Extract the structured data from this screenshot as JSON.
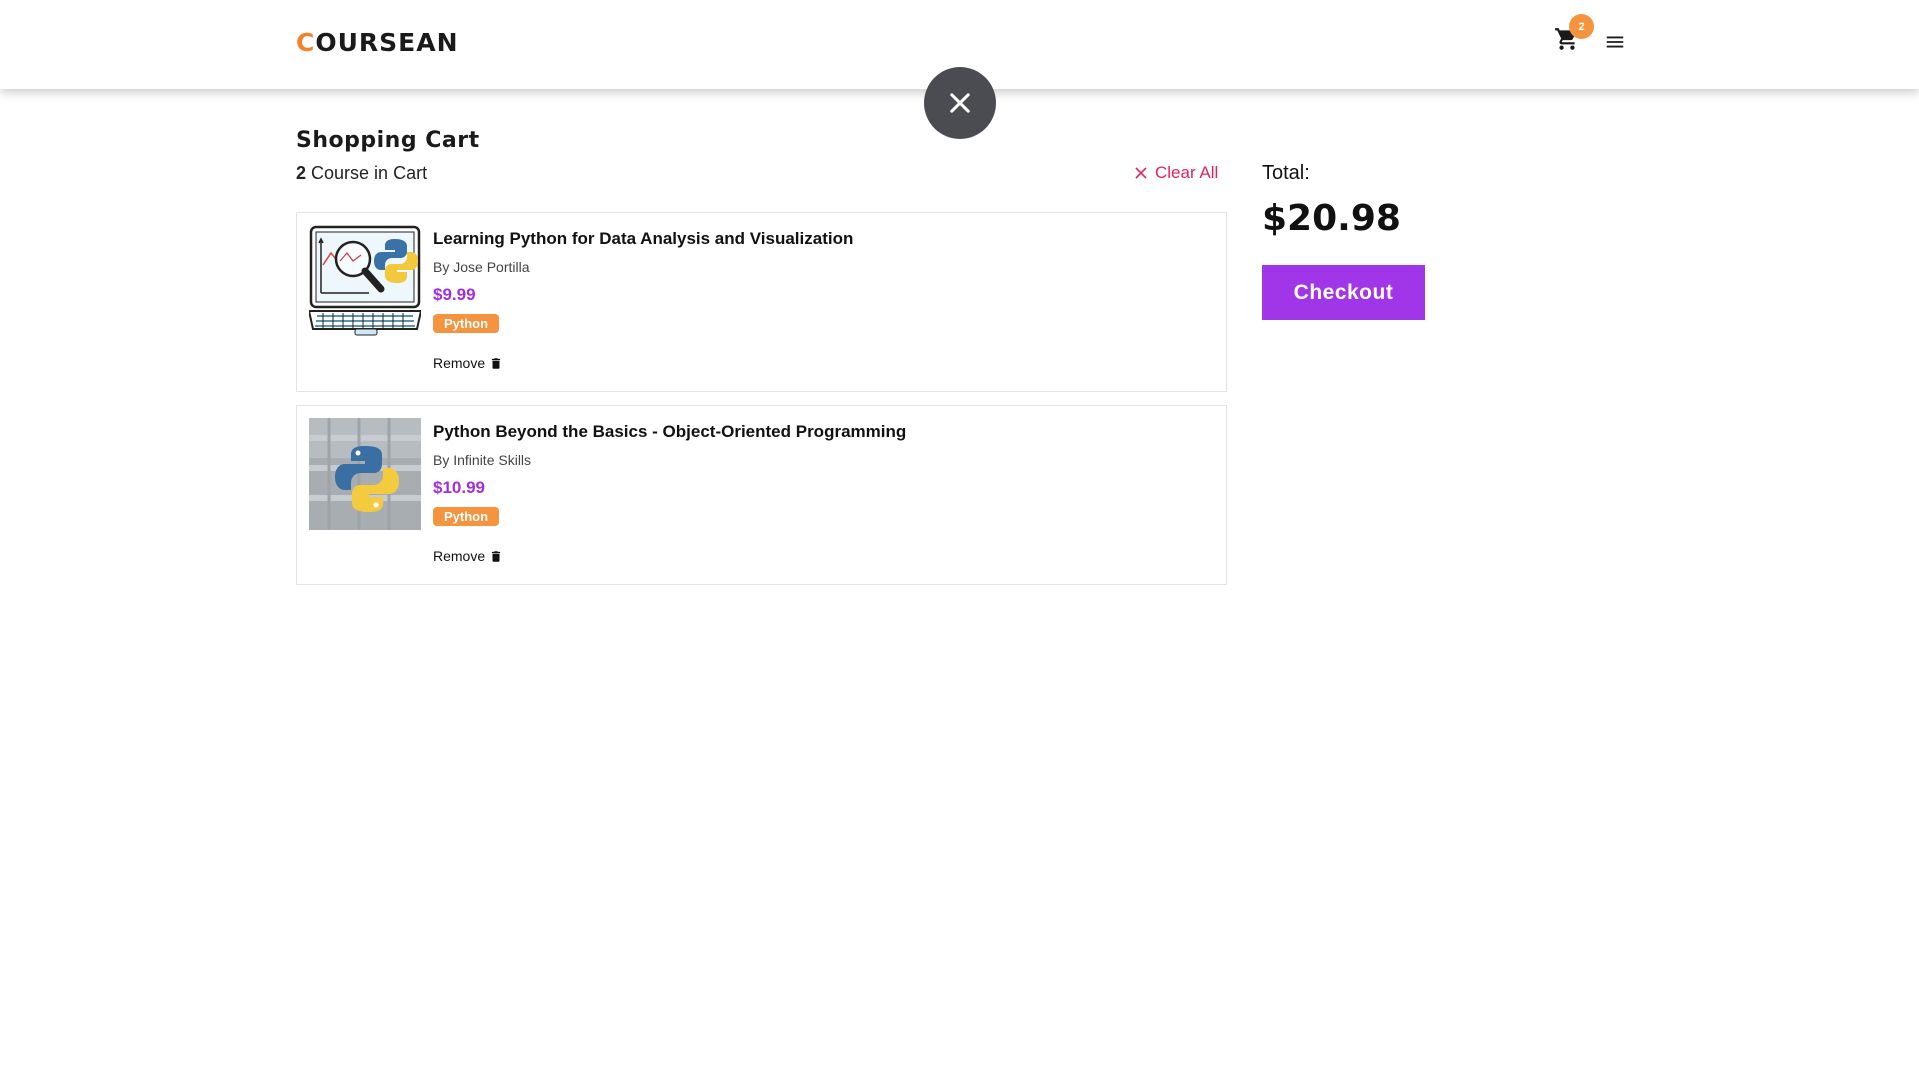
{
  "header": {
    "logo_first": "C",
    "logo_rest": "OURSEAN",
    "cart_icon": "cart-icon",
    "cart_count": "2",
    "menu_icon": "hamburger-menu-icon"
  },
  "overlay": {
    "close_icon": "close-icon"
  },
  "cart": {
    "title": "Shopping Cart",
    "count": "2",
    "count_suffix": "Course in Cart",
    "clear_all_label": "Clear All",
    "items": [
      {
        "title": "Learning Python for Data Analysis and Visualization",
        "author": "By Jose Portilla",
        "price": "$9.99",
        "tag": "Python",
        "remove_label": "Remove"
      },
      {
        "title": "Python Beyond the Basics - Object-Oriented Programming",
        "author": "By Infinite Skills",
        "price": "$10.99",
        "tag": "Python",
        "remove_label": "Remove"
      }
    ]
  },
  "summary": {
    "total_label": "Total:",
    "total_amount": "$20.98",
    "checkout_label": "Checkout"
  },
  "colors": {
    "brand_orange": "#f5812a",
    "price_purple": "#a32ee0",
    "checkout_purple": "#a135e8",
    "clear_red": "#e0245e"
  }
}
